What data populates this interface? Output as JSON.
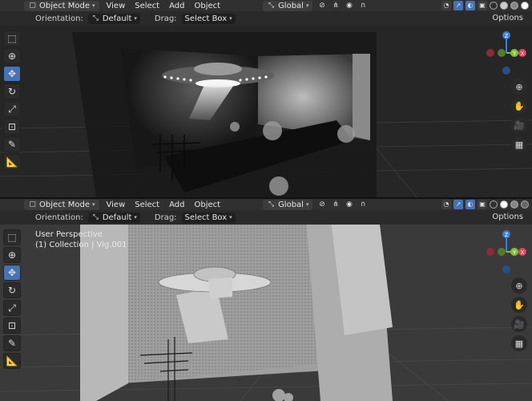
{
  "header": {
    "mode": "Object Mode",
    "menus": [
      "View",
      "Select",
      "Add",
      "Object"
    ],
    "transform_orientation": "Global",
    "options": "Options"
  },
  "subheader": {
    "orientation_label": "Orientation:",
    "orientation_value": "Default",
    "drag_label": "Drag:",
    "drag_value": "Select Box"
  },
  "viewport2_info": {
    "line1": "User Perspective",
    "line2": "(1) Collection | Vig.001"
  },
  "gizmo": {
    "z": "Z",
    "y": "Y",
    "x": "X"
  },
  "colors": {
    "accent": "#4772b3",
    "axis_x": "#e0465a",
    "axis_y": "#7fbf3a",
    "axis_z": "#3d7fd6"
  }
}
